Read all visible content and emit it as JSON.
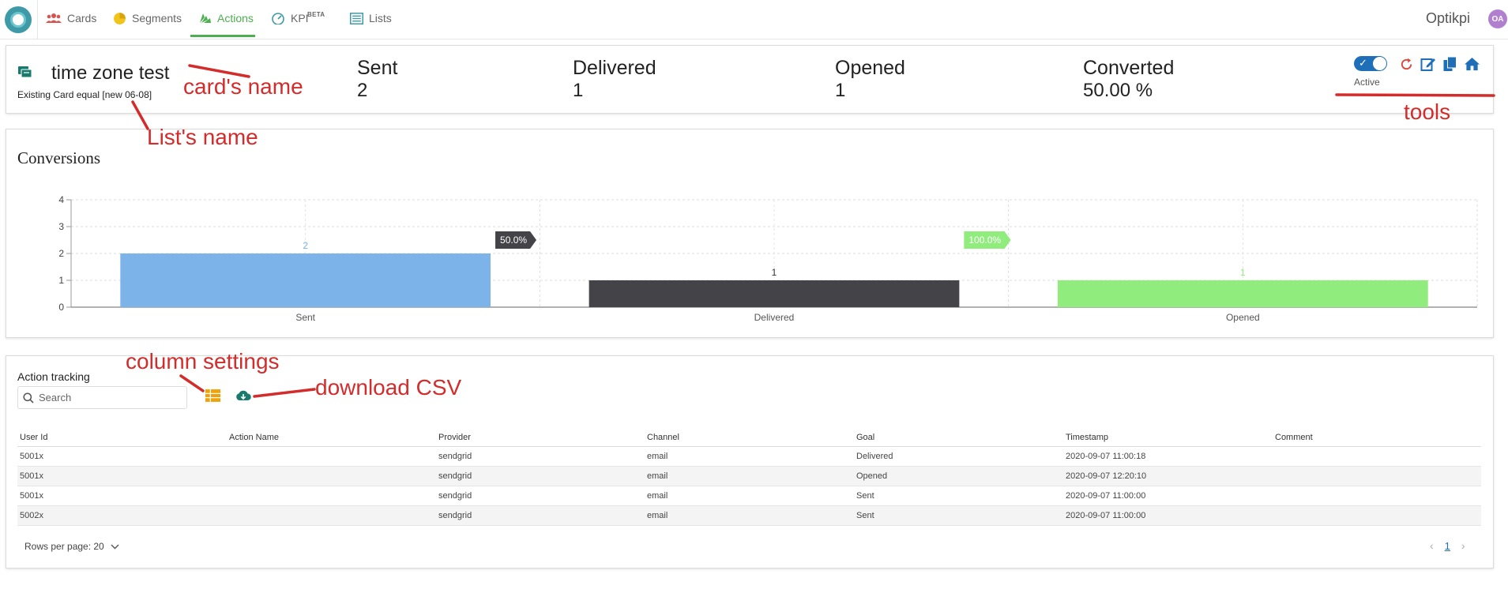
{
  "nav": {
    "items": [
      {
        "label": "Cards",
        "icon": "users-icon"
      },
      {
        "label": "Segments",
        "icon": "pie-icon"
      },
      {
        "label": "Actions",
        "icon": "actions-icon"
      },
      {
        "label": "KPI",
        "icon": "gauge-icon",
        "badge": "BETA"
      },
      {
        "label": "Lists",
        "icon": "list-icon"
      }
    ],
    "active": "Actions",
    "brand": "Optikpi",
    "avatar_initials": "OA"
  },
  "card": {
    "name": "time zone test",
    "list": "Existing Card equal [new 06-08]",
    "stats": [
      {
        "label": "Sent",
        "value": "2"
      },
      {
        "label": "Delivered",
        "value": "1"
      },
      {
        "label": "Opened",
        "value": "1"
      },
      {
        "label": "Converted",
        "value": "50.00 %"
      }
    ],
    "status_label": "Active",
    "active": true,
    "tools": [
      "refresh-icon",
      "edit-icon",
      "copy-icon",
      "home-icon"
    ]
  },
  "annotations": {
    "card_name": "card's name",
    "list_name": "List's name",
    "tools": "tools",
    "column_settings": "column settings",
    "download_csv": "download CSV"
  },
  "colors": {
    "accent_green": "#4caf50",
    "toggle_blue": "#1e6fb8",
    "annotation_red": "#d42b2b",
    "bar_sent": "#7cb4ea",
    "bar_delivered": "#434348",
    "bar_opened": "#90ed7d"
  },
  "chart_data": {
    "type": "bar",
    "title": "Conversions",
    "categories": [
      "Sent",
      "Delivered",
      "Opened"
    ],
    "values": [
      2,
      1,
      1
    ],
    "data_labels": [
      "2",
      "1",
      "1"
    ],
    "bar_colors": [
      "#7cb4ea",
      "#434348",
      "#90ed7d"
    ],
    "conversion_tags": [
      {
        "after": "Sent",
        "label": "50.0%",
        "color": "#434348"
      },
      {
        "after": "Delivered",
        "label": "100.0%",
        "color": "#90ed7d"
      }
    ],
    "ylim": [
      0,
      4
    ],
    "yticks": [
      "0",
      "1",
      "2",
      "3",
      "4"
    ],
    "grid": true
  },
  "tracking": {
    "title": "Action tracking",
    "search_placeholder": "Search",
    "columns": [
      "User Id",
      "Action Name",
      "Provider",
      "Channel",
      "Goal",
      "Timestamp",
      "Comment"
    ],
    "rows": [
      [
        "5001x",
        "",
        "sendgrid",
        "email",
        "Delivered",
        "2020-09-07 11:00:18",
        ""
      ],
      [
        "5001x",
        "",
        "sendgrid",
        "email",
        "Opened",
        "2020-09-07 12:20:10",
        ""
      ],
      [
        "5001x",
        "",
        "sendgrid",
        "email",
        "Sent",
        "2020-09-07 11:00:00",
        ""
      ],
      [
        "5002x",
        "",
        "sendgrid",
        "email",
        "Sent",
        "2020-09-07 11:00:00",
        ""
      ]
    ],
    "rows_per_page": "Rows per page: 20",
    "current_page": "1"
  }
}
